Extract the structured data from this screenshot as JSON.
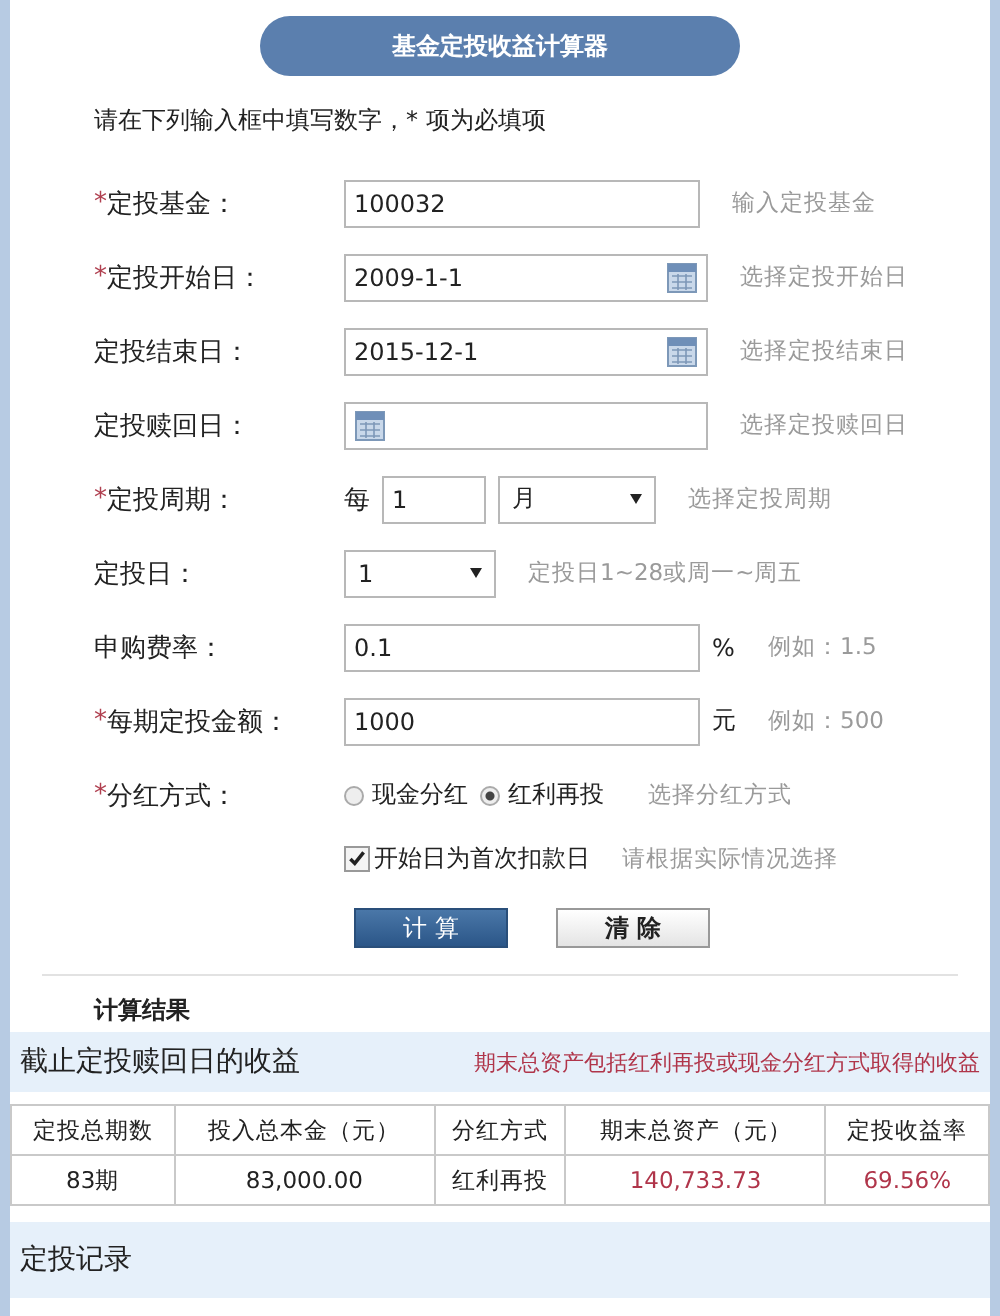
{
  "title": "基金定投收益计算器",
  "instruction": "请在下列输入框中填写数字，* 项为必填项",
  "fields": [
    {
      "kind": "text",
      "asterisk": "*",
      "label": "定投基金：",
      "value": "100032",
      "hint": "输入定投基金"
    },
    {
      "kind": "date",
      "asterisk": "*",
      "label": "定投开始日：",
      "value": "2009-1-1",
      "hint": "选择定投开始日"
    },
    {
      "kind": "date",
      "label": "定投结束日：",
      "value": "2015-12-1",
      "hint": "选择定投结束日"
    },
    {
      "kind": "date",
      "label": "定投赎回日：",
      "hint": "选择定投赎回日"
    },
    {
      "kind": "period",
      "asterisk": "*",
      "label": "定投周期：",
      "prefix": "每",
      "value": "1",
      "option": "月",
      "hint": "选择定投周期"
    },
    {
      "kind": "select",
      "label": "定投日：",
      "value": "1",
      "hint": "定投日1~28或周一~周五"
    },
    {
      "kind": "text",
      "label": "申购费率：",
      "value": "0.1",
      "unit": "%",
      "hint": "例如：1.5"
    },
    {
      "kind": "text",
      "asterisk": "*",
      "label": "每期定投金额：",
      "value": "1000",
      "unit": "元",
      "hint": "例如：500"
    },
    {
      "kind": "radio",
      "asterisk": "*",
      "label": "分红方式：",
      "options": [
        {
          "label": "现金分红",
          "selected": false
        },
        {
          "label": "红利再投",
          "selected": true
        }
      ],
      "hint": "选择分红方式"
    },
    {
      "kind": "checkbox",
      "checked": true,
      "text": "开始日为首次扣款日",
      "hint": "请根据实际情况选择"
    }
  ],
  "buttons": [
    {
      "label": "计 算",
      "kind": "primary"
    },
    {
      "label": "清 除",
      "kind": "secondary"
    }
  ],
  "results": {
    "heading": "计算结果",
    "summary_title": "截止定投赎回日的收益",
    "note": "期末总资产包括红利再投或现金分红方式取得的收益",
    "columns": [
      "定投总期数",
      "投入总本金（元）",
      "分红方式",
      "期末总资产（元）",
      "定投收益率"
    ],
    "rows": [
      {
        "cells": [
          "83期",
          "83,000.00",
          "红利再投",
          "140,733.73",
          "69.56%"
        ]
      }
    ]
  },
  "records": {
    "heading": "定投记录"
  }
}
